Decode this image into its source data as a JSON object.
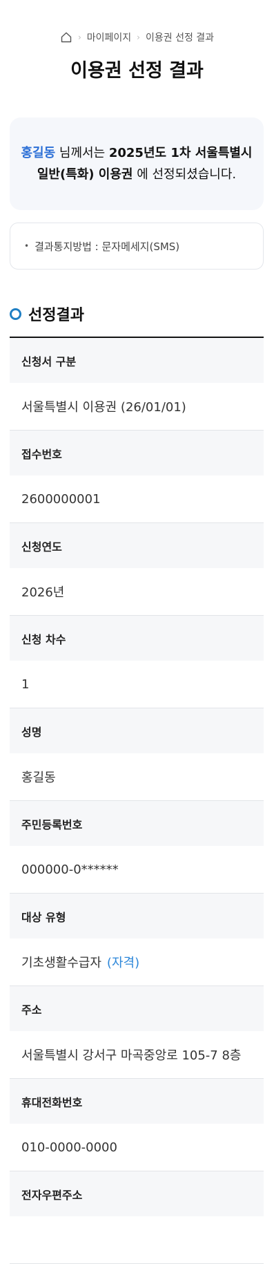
{
  "breadcrumb": {
    "home_icon": "home-icon",
    "items": [
      "마이페이지",
      "이용권 선정 결과"
    ]
  },
  "page_title": "이용권 선정 결과",
  "notice": {
    "name": "홍길동",
    "text1": " 님께서는 ",
    "highlight1": "2025년도 1차 서울특별시",
    "highlight2": "일반(특화) 이용권",
    "text2": " 에 선정되셨습니다."
  },
  "method": {
    "text": "결과통지방법 : 문자메세지(SMS)"
  },
  "section": {
    "title": "선정결과"
  },
  "rows": [
    {
      "label": "신청서 구분",
      "value": "서울특별시 이용권 (26/01/01)"
    },
    {
      "label": "접수번호",
      "value": "2600000001"
    },
    {
      "label": "신청연도",
      "value": "2026년"
    },
    {
      "label": "신청 차수",
      "value": "1"
    },
    {
      "label": "성명",
      "value": "홍길동"
    },
    {
      "label": "주민등록번호",
      "value": "000000-0******"
    },
    {
      "label": "대상 유형",
      "value": "기초생활수급자",
      "note": "(자격)"
    },
    {
      "label": "주소",
      "value": "서울특별시 강서구 마곡중앙로 105-7 8층"
    },
    {
      "label": "휴대전화번호",
      "value": "010-0000-0000"
    },
    {
      "label": "전자우편주소",
      "value": ""
    }
  ],
  "colors": {
    "accent": "#2b6fd6",
    "section_ring": "#1f7fc4"
  }
}
